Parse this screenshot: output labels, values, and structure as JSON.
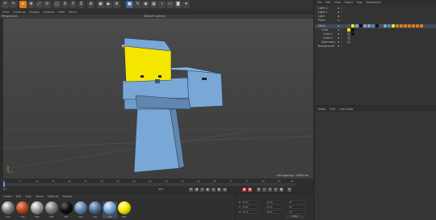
{
  "toolbar": {
    "icons": [
      "undo-icon",
      "redo-icon",
      "select-icon",
      "move-icon",
      "scale-icon",
      "rotate-icon",
      "cube-icon",
      "axis-x-icon",
      "axis-y-icon",
      "axis-z-icon",
      "coords-icon",
      "render-icon",
      "render-view-icon",
      "render-settings-icon",
      "cube-primitive-icon",
      "pen-icon",
      "subdivision-icon",
      "array-icon",
      "deformer-icon",
      "floor-icon",
      "camera-icon",
      "light-icon"
    ],
    "axis_labels": [
      "X",
      "Y",
      "Z"
    ]
  },
  "viewport_menu": [
    "View",
    "Cameras",
    "Display",
    "Options",
    "Filter",
    "Panel"
  ],
  "viewport": {
    "name": "Perspective",
    "camera": "Default Camera",
    "grid_spacing": "Grid Spacing : 10000 cm"
  },
  "object_manager": {
    "menu": [
      "File",
      "Edit",
      "View",
      "Object",
      "Tags",
      "Bookmarks"
    ],
    "objects": [
      {
        "name": "Light.2"
      },
      {
        "name": "Light.1"
      },
      {
        "name": "Light"
      },
      {
        "name": "Plane"
      },
      {
        "name": "Mesh"
      },
      {
        "name": "Cube"
      },
      {
        "name": "Cube.1"
      },
      {
        "name": "Cube.2"
      },
      {
        "name": "Symmetry"
      },
      {
        "name": "Background"
      }
    ]
  },
  "attributes": {
    "menu": [
      "Mode",
      "Edit",
      "User Data"
    ]
  },
  "timeline": {
    "ticks": [
      "0",
      "5",
      "10",
      "15",
      "20",
      "25",
      "30",
      "35",
      "40",
      "45",
      "50",
      "55",
      "60",
      "65",
      "70",
      "75",
      "80",
      "85",
      "90"
    ],
    "current_frame": "0 F",
    "end_frame": "90 F",
    "start_frame": "0 F"
  },
  "material_manager": {
    "menu": [
      "Create",
      "Edit",
      "View",
      "Select",
      "Material",
      "Texture"
    ],
    "materials": [
      {
        "name": "Mat",
        "color": "#808080"
      },
      {
        "name": "Mat",
        "color": "#b34a1f"
      },
      {
        "name": "Mat",
        "color": "#9a9a9a"
      },
      {
        "name": "Mat",
        "color": "#7d7d7d"
      },
      {
        "name": "Mat",
        "color": "#111111"
      },
      {
        "name": "Mat",
        "color": "#5c86ad"
      },
      {
        "name": "Mat",
        "color": "#4f6f8f"
      },
      {
        "name": "Mat",
        "color": "#79a7d6"
      },
      {
        "name": "Mat",
        "color": "#f5e600"
      }
    ]
  },
  "coordinates": {
    "rows": [
      {
        "axis": "X",
        "pos": "0 cm",
        "size": "0 cm",
        "rot": "0°"
      },
      {
        "axis": "Y",
        "pos": "0 cm",
        "size": "0 cm",
        "rot": "0°"
      },
      {
        "axis": "Z",
        "pos": "0 cm",
        "size": "0 cm",
        "rot": "0°"
      }
    ],
    "apply_label": "Apply"
  },
  "colors": {
    "model_blue": "#79a7d6",
    "model_yellow": "#f5e600",
    "selection": "#3d4b5a",
    "accent_orange": "#e07b1a"
  }
}
